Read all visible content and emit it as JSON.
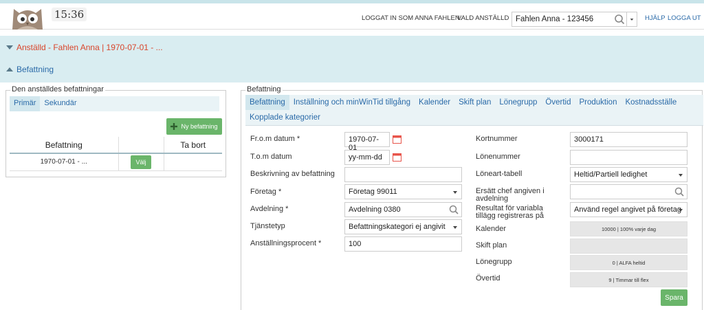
{
  "header": {
    "clock": "15:36",
    "logged_in": "LOGGAT IN SOM ANNA FAHLEN.",
    "chosen_employee_label": "VALD ANSTÄLLD",
    "employee_value": "Fahlen Anna  - 123456",
    "help": "HJÄLP",
    "logout": "LOGGA UT"
  },
  "band": {
    "employee_row": "Anställd - Fahlen Anna | 1970-07-01 - ...",
    "section_row": "Befattning"
  },
  "left": {
    "legend": "Den anställdes befattningar",
    "tabs": [
      "Primär",
      "Sekundär"
    ],
    "new_button": "Ny befattning",
    "columns": [
      "Befattning",
      "",
      "Ta bort"
    ],
    "row": {
      "befattning": "1970-07-01 - ...",
      "action": "Välj"
    }
  },
  "right": {
    "legend": "Befattning",
    "tabs": [
      "Befattning",
      "Inställning och minWinTid tillgång",
      "Kalender",
      "Skift plan",
      "Lönegrupp",
      "Övertid",
      "Produktion",
      "Kostnadsställe",
      "Kopplade kategorier"
    ],
    "form_left": [
      {
        "label": "Fr.o.m datum *",
        "value": "1970-07-01"
      },
      {
        "label": "T.o.m datum",
        "value": "yy-mm-dd"
      },
      {
        "label": "Beskrivning av befattning",
        "value": ""
      },
      {
        "label": "Företag *",
        "value": "Företag 99011"
      },
      {
        "label": "Avdelning *",
        "value": "Avdelning 0380"
      },
      {
        "label": "Tjänstetyp",
        "value": "Befattningskategori ej angivit"
      },
      {
        "label": "Anställningsprocent *",
        "value": "100"
      }
    ],
    "form_right": [
      {
        "label": "Kortnummer",
        "value": "3000171"
      },
      {
        "label": "Lönenummer",
        "value": ""
      },
      {
        "label": "Löneart-tabell",
        "value": "Heltid/Partiell ledighet"
      },
      {
        "label_1": "Ersätt chef angiven i",
        "label_2": "avdelning",
        "value": ""
      },
      {
        "label_1": "Resultat för variabla",
        "label_2": "tillägg registreras på",
        "value": "Använd regel angivet på företag"
      },
      {
        "label": "Kalender",
        "value": "10000 | 100% varje dag"
      },
      {
        "label": "Skift plan",
        "value": ""
      },
      {
        "label": "Lönegrupp",
        "value": "0 | ALFA heltid"
      },
      {
        "label": "Övertid",
        "value": "9 | Timmar till flex"
      }
    ],
    "save": "Spara"
  },
  "colors": {
    "accent_red": "#d9452b",
    "link_blue": "#2a6aa8",
    "band_bg": "#d9edf1",
    "button_green": "#6ab56a",
    "calendar_red": "#e8544a"
  },
  "icons": [
    "owl-logo-icon",
    "search-icon",
    "chevron-down-icon",
    "calendar-icon",
    "plus-icon",
    "triangle-down-icon",
    "triangle-up-icon"
  ]
}
